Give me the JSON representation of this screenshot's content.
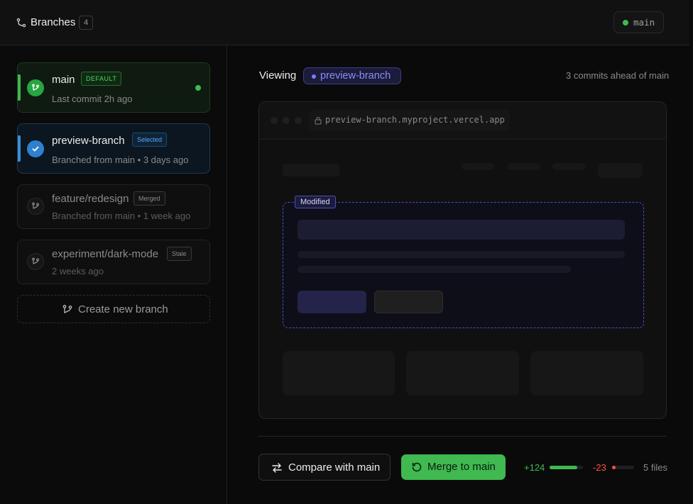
{
  "header": {
    "title": "Branches",
    "count": "4",
    "current_branch": "main",
    "title_icon": "git-branch-icon"
  },
  "sidebar": {
    "branches": [
      {
        "name": "main",
        "badge": "DEFAULT",
        "subtitle": "Last commit 2h ago",
        "status": "active",
        "icon": "git-branch-icon"
      },
      {
        "name": "preview-branch",
        "badge": "Selected",
        "subtitle": "Branched from main • 3 days ago",
        "status": "selected",
        "icon": "check-icon"
      },
      {
        "name": "feature/redesign",
        "badge": "Merged",
        "subtitle": "Branched from main • 1 week ago",
        "status": "merged",
        "icon": "git-branch-icon"
      },
      {
        "name": "experiment/dark-mode",
        "badge": "Stale",
        "subtitle": "2 weeks ago",
        "status": "stale",
        "icon": "git-branch-icon"
      }
    ],
    "create_label": "Create new branch"
  },
  "main": {
    "viewing_label": "Viewing",
    "viewing_branch": "preview-branch",
    "ahead_text": "3 commits ahead of main",
    "preview": {
      "url": "preview-branch.myproject.vercel.app",
      "modified_label": "Modified"
    },
    "actions": {
      "compare_label": "Compare with main",
      "merge_label": "Merge to main"
    },
    "diff": {
      "additions": "+124",
      "deletions": "-23",
      "additions_fraction": 0.84,
      "deletions_fraction": 0.16,
      "files": "5 files"
    }
  },
  "colors": {
    "accent_green": "#3fb950",
    "accent_blue": "#2f81d0",
    "accent_purple": "#7c7cff",
    "deletion_red": "#f85149",
    "background": "#0a0a0a"
  }
}
